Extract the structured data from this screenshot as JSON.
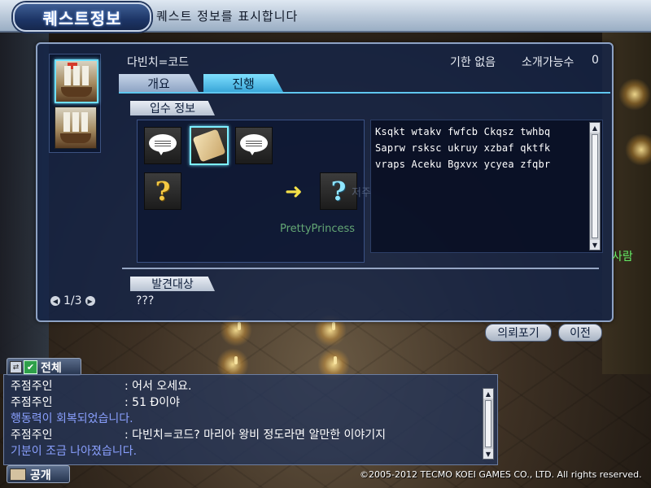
{
  "title_bar": {
    "title": "퀘스트정보",
    "description": "퀘스트 정보를 표시합니다"
  },
  "quest": {
    "name": "다빈치=코드",
    "deadline": "기한 없음",
    "intro_label": "소개가능수",
    "intro_count": "0"
  },
  "tabs": [
    {
      "label": "개요",
      "active": false
    },
    {
      "label": "진행",
      "active": true
    }
  ],
  "sections": {
    "acquisition_label": "입수 정보",
    "discovery_label": "발견대상",
    "discovery_value": "???"
  },
  "description_text": "Ksqkt wtakv fwfcb Ckqsz twhbq\nSaprw rsksc ukruy xzbaf qktfk\nvraps Aceku Bgxvx ycyea zfqbr",
  "pager": {
    "text": "1/3"
  },
  "buttons": {
    "give_up": "의뢰포기",
    "previous": "이전"
  },
  "overlay_names": {
    "ghost_text": "저주",
    "player": "PrettyPrincess",
    "people": "사람"
  },
  "chat": {
    "channel": "전체",
    "mode": "공개",
    "lines": [
      {
        "speaker": "주점주인",
        "message": ": 어서 오세요.",
        "system": false
      },
      {
        "speaker": "주점주인",
        "message": ": 51 Đ이야",
        "system": false
      },
      {
        "speaker": "",
        "message": "행동력이 회복되었습니다.",
        "system": true
      },
      {
        "speaker": "주점주인",
        "message": ": 다빈치=코드? 마리아 왕비 정도라면 알만한 이야기지",
        "system": false
      },
      {
        "speaker": "",
        "message": "기분이 조금 나아졌습니다.",
        "system": true
      }
    ]
  },
  "copyright": "©2005-2012 TECMO KOEI GAMES CO., LTD. All rights reserved.",
  "colors": {
    "accent_tab": "#3aa6d8",
    "system_text": "#8aa0ff",
    "arrow": "#f4e048"
  }
}
